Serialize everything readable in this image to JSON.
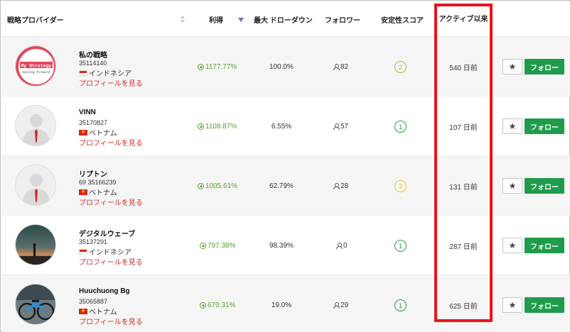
{
  "colors": {
    "accent_green": "#1f9b4c",
    "profit_green": "#5a9e2f",
    "link_red": "#d12b2b",
    "highlight_red": "#e8141b",
    "score_1": "#2e9a4e",
    "score_2": "#8cc63f",
    "score_3": "#f0c22d"
  },
  "header": {
    "provider": "戦略プロバイダー",
    "profit": "利得",
    "max_drawdown": "最大 ドローダウン",
    "followers": "フォロワー",
    "stability": "安定性スコア",
    "active_since": "アクティブ以来"
  },
  "rows": [
    {
      "name": "私の戦略",
      "account": "35114140",
      "country": "インドネシア",
      "flag": "indonesia-flag",
      "profile_link": "プロフィールを見る",
      "avatar": "my-strategy-logo",
      "avatar_text_1": "My Strategy",
      "avatar_text_2": "moving forward",
      "profit": "1177.77%",
      "drawdown": "100.0%",
      "followers": "82",
      "stability_score": "2",
      "score_color": "#8cc63f",
      "active": "540 日前",
      "follow_label": "フォロー"
    },
    {
      "name": "VINN",
      "account": "35170827",
      "country": "ベトナム",
      "flag": "vietnam-flag",
      "profile_link": "プロフィールを見る",
      "avatar": "default-user-avatar",
      "profit": "1108.87%",
      "drawdown": "6.55%",
      "followers": "57",
      "stability_score": "1",
      "score_color": "#2e9a4e",
      "active": "107 日前",
      "follow_label": "フォロー"
    },
    {
      "name": "リプトン",
      "account": "69 35166239",
      "country": "ベトナム",
      "flag": "vietnam-flag",
      "profile_link": "プロフィールを見る",
      "avatar": "default-user-avatar",
      "profit": "1005.61%",
      "drawdown": "62.79%",
      "followers": "28",
      "stability_score": "3",
      "score_color": "#f0c22d",
      "active": "131 日前",
      "follow_label": "フォロー"
    },
    {
      "name": "デジタルウェーブ",
      "account": "35137291",
      "country": "インドネシア",
      "flag": "indonesia-flag",
      "profile_link": "プロフィールを見る",
      "avatar": "sunset-silhouette-photo",
      "profit": "797.38%",
      "drawdown": "98.39%",
      "followers": "0",
      "stability_score": "1",
      "score_color": "#2e9a4e",
      "active": "287 日前",
      "follow_label": "フォロー"
    },
    {
      "name": "Huuchuong Bg",
      "account": "35065887",
      "country": "ベトナム",
      "flag": "vietnam-flag",
      "profile_link": "プロフィールを見る",
      "avatar": "bicycle-photo",
      "profit": "670.31%",
      "drawdown": "19.0%",
      "followers": "29",
      "stability_score": "1",
      "score_color": "#2e9a4e",
      "active": "625 日前",
      "follow_label": "フォロー"
    }
  ]
}
